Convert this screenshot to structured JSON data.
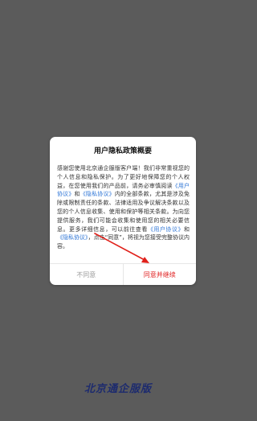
{
  "dialog": {
    "title": "用户隐私政策概要",
    "body": {
      "p1": "感谢您使用北京通企服版客户端！我们非常重视您的个人信息和隐私保护。为了更好地保障您的个人权益，在您使用我们的产品前，请务必审慎阅读",
      "link_user_agreement": "《用户协议》",
      "and1": "和",
      "link_privacy_policy": "《隐私协议》",
      "p2": "内的全部条款，尤其是涉及免除或限制责任的条款、法律适用及争议解决条款以及您的个人信息收集、使用和保护等相关条款。为向您提供服务，我们可能会收集和使用您的相关必要信息。更多详细信息，可以前往查看",
      "link_user_agreement_2": "《用户协议》",
      "and2": "和",
      "link_privacy_policy_2": "《隐私协议》",
      "p3": "，点击“同意”，将视为您接受完整协议内容。"
    },
    "buttons": {
      "disagree": "不同意",
      "agree": "同意并继续"
    }
  },
  "brand": {
    "name": "北京通企服版"
  },
  "colors": {
    "overlay": "#5b5b5b",
    "link": "#2f76d6",
    "agree": "#e02020",
    "disagree": "#9a9a9a",
    "brand": "#1d2b6e",
    "arrow": "#e0201a"
  }
}
